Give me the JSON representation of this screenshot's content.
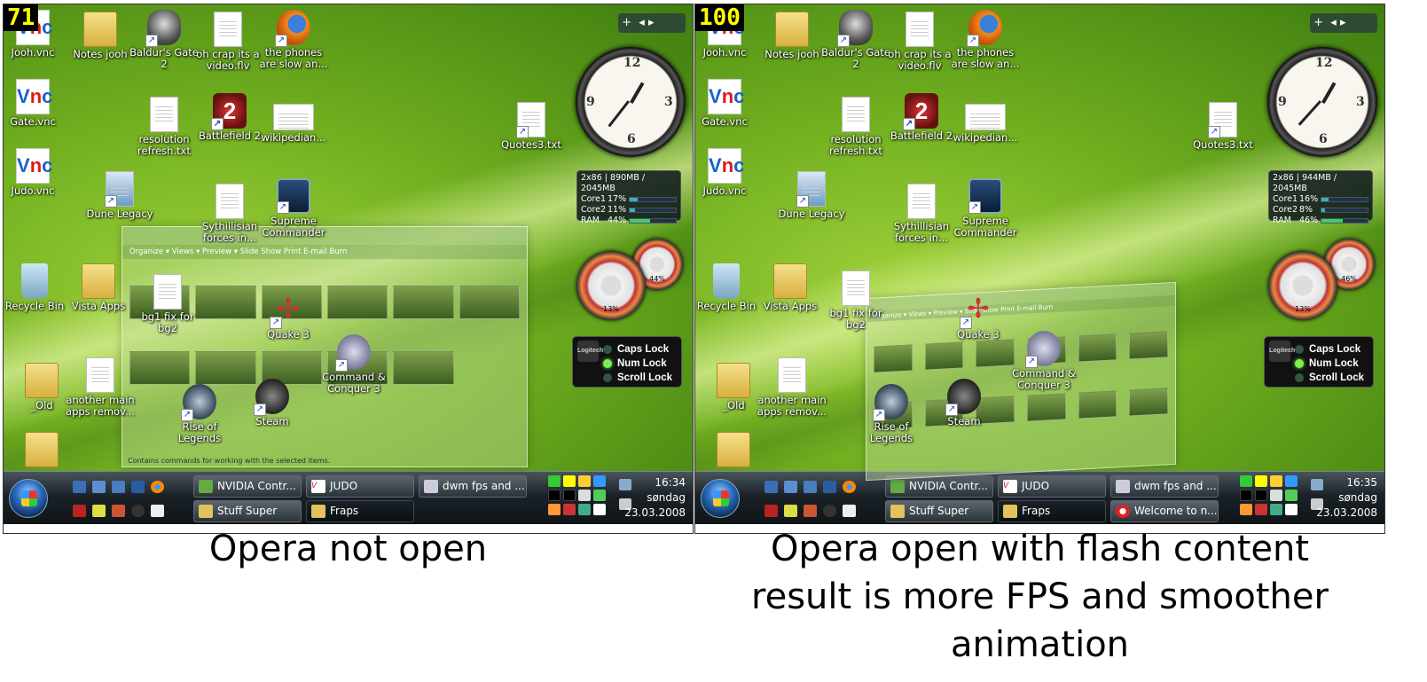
{
  "screens": [
    {
      "fps": "71",
      "desktop_icons": {
        "jooh_vnc": "Jooh.vnc",
        "gate_vnc": "Gate.vnc",
        "judo_vnc": "Judo.vnc",
        "notes_jooh": "Notes jooh",
        "baldurs_gate": "Baldur's Gate 2",
        "oh_crap": "oh crap its a video.flv",
        "phones": "the phones are slow an...",
        "resolution": "resolution refresh.txt",
        "battlefield": "Battlefield 2",
        "wikipedian": "wikipedian...",
        "quotes": "Quotes3.txt",
        "dune": "Dune Legacy",
        "sythillisian": "Sythillisian forces in...",
        "supreme": "Supreme Commander",
        "recycle": "Recycle Bin",
        "vista_apps": "Vista Apps",
        "bg1": "bg1 fix for bg2",
        "quake": "Quake 3",
        "cnc": "Command & Conquer 3",
        "rise": "Rise of Legends",
        "steam": "Steam",
        "old": "_Old",
        "another": "another main apps remov..."
      },
      "cpu_meter": {
        "memory": "2x86 | 890MB / 2045MB",
        "core1": "Core1",
        "core1_pct": "17%",
        "core2": "Core2",
        "core2_pct": "11%",
        "ram": "RAM",
        "ram_pct": "44%"
      },
      "meters": {
        "cpu": "13%",
        "mem": "44%"
      },
      "locks": {
        "caps": "Caps Lock",
        "num": "Num Lock",
        "scroll": "Scroll Lock",
        "logo": "Logitech"
      },
      "explorer": {
        "toolbar": "Organize ▾   Views ▾   Preview ▾   Slide Show   Print   E-mail   Burn",
        "status": "Contains commands for working with the selected items."
      },
      "tasks": {
        "t1": "NVIDIA Contr...",
        "t2": "JUDO",
        "t3": "dwm fps and ...",
        "t4": "Stuff Super",
        "t5": "Fraps"
      },
      "clock": {
        "time": "16:34",
        "day": "søndag",
        "date": "23.03.2008"
      }
    },
    {
      "fps": "100",
      "desktop_icons": {
        "jooh_vnc": "Jooh.vnc",
        "gate_vnc": "Gate.vnc",
        "judo_vnc": "Judo.vnc",
        "notes_jooh": "Notes jooh",
        "baldurs_gate": "Baldur's Gate 2",
        "oh_crap": "oh crap its a video.flv",
        "phones": "the phones are slow an...",
        "resolution": "resolution refresh.txt",
        "battlefield": "Battlefield 2",
        "wikipedian": "wikipedian...",
        "quotes": "Quotes3.txt",
        "dune": "Dune Legacy",
        "sythillisian": "Sythillisian forces in...",
        "supreme": "Supreme Commander",
        "recycle": "Recycle Bin",
        "vista_apps": "Vista Apps",
        "bg1": "bg1 fix for bg2",
        "quake": "Quake 3",
        "cnc": "Command & Conquer 3",
        "rise": "Rise of Legends",
        "steam": "Steam",
        "old": "_Old",
        "another": "another main apps remov..."
      },
      "cpu_meter": {
        "memory": "2x86 | 944MB / 2045MB",
        "core1": "Core1",
        "core1_pct": "16%",
        "core2": "Core2",
        "core2_pct": "8%",
        "ram": "RAM",
        "ram_pct": "46%"
      },
      "meters": {
        "cpu": "13%",
        "mem": "46%"
      },
      "locks": {
        "caps": "Caps Lock",
        "num": "Num Lock",
        "scroll": "Scroll Lock",
        "logo": "Logitech"
      },
      "explorer": {
        "toolbar": "Organize ▾   Views ▾   Preview ▾   Slide Show   Print   E-mail   Burn",
        "status": ""
      },
      "tasks": {
        "t1": "NVIDIA Contr...",
        "t2": "JUDO",
        "t3": "dwm fps and ...",
        "t4": "Stuff Super",
        "t5": "Fraps",
        "t6": "Welcome to n..."
      },
      "clock": {
        "time": "16:35",
        "day": "søndag",
        "date": "23.03.2008"
      }
    }
  ],
  "captions": {
    "left": "Opera not open",
    "right_line1": "Opera open with flash content",
    "right_line2": "result is more FPS and smoother",
    "right_line3": "animation"
  }
}
